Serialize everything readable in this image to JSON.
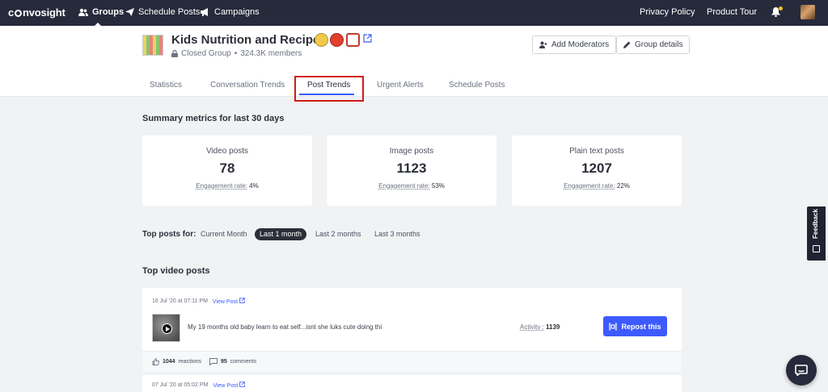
{
  "nav": {
    "logo": "convosight",
    "items": [
      {
        "label": "Groups",
        "icon": "users-icon"
      },
      {
        "label": "Schedule Posts",
        "icon": "send-icon"
      },
      {
        "label": "Campaigns",
        "icon": "megaphone-icon"
      }
    ],
    "privacy": "Privacy Policy",
    "tour": "Product Tour"
  },
  "group": {
    "title": "Kids Nutrition and Recipes",
    "privacy": "Closed Group",
    "separator": "•",
    "members": "324.3K members",
    "add_moderators": "Add Moderators",
    "group_details": "Group details"
  },
  "tabs": [
    {
      "label": "Statistics"
    },
    {
      "label": "Conversation Trends"
    },
    {
      "label": "Post Trends"
    },
    {
      "label": "Urgent Alerts"
    },
    {
      "label": "Schedule Posts"
    }
  ],
  "summary": {
    "title": "Summary metrics for last 30 days",
    "cards": [
      {
        "label": "Video posts",
        "value": "78",
        "rate_label": "Engagement rate:",
        "rate": "4%"
      },
      {
        "label": "Image posts",
        "value": "1123",
        "rate_label": "Engagement rate:",
        "rate": "53%"
      },
      {
        "label": "Plain text posts",
        "value": "1207",
        "rate_label": "Engagement rate:",
        "rate": "22%"
      }
    ]
  },
  "filter": {
    "label": "Top posts for:",
    "options": [
      "Current Month",
      "Last 1 month",
      "Last 2 months",
      "Last 3 months"
    ],
    "selected": "Last 1 month"
  },
  "top_video": {
    "title": "Top video posts",
    "posts": [
      {
        "date": "16 Jul '20 at 07:11 PM",
        "view": "View Post",
        "text": "My 19 months old baby learn to eat self...isnt she luks cute doing thi",
        "activity_label": "Activity :",
        "activity": "1139",
        "repost": "Repost this",
        "reactions": "1044",
        "reactions_label": "reactions",
        "comments": "95",
        "comments_label": "comments"
      },
      {
        "date": "07 Jul '20 at 05:02 PM",
        "view": "View Post"
      }
    ]
  },
  "feedback": "Feedback",
  "colors": {
    "accent": "#3d5afe",
    "nav_bg": "#262a3b",
    "highlight": "#d11a1a"
  }
}
